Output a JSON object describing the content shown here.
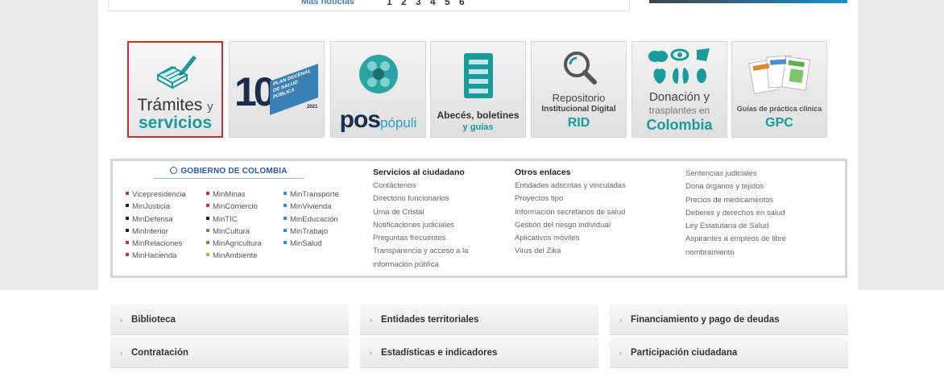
{
  "top": {
    "mas_noticias": "Más noticias",
    "pager": "1 2 3 4 5 6"
  },
  "tiles": {
    "tramites": {
      "l1": "Trámites",
      "l1_small": "y",
      "l2": "servicios"
    },
    "plan_decenal": {
      "number": "10",
      "text": "PLAN DECENAL DE SALUD PÚBLICA",
      "year": "2021"
    },
    "pospopuli": {
      "pos": "pos",
      "populi": "pópuli"
    },
    "abeces": {
      "l1": "Abecés, boletines",
      "l2": "y guías"
    },
    "repositorio": {
      "l1": "Repositorio",
      "l2": "Institucional Digital",
      "l3": "RID"
    },
    "donacion": {
      "l1": "Donación y",
      "l2": "trasplantes en",
      "l3": "Colombia"
    },
    "gpc": {
      "l1": "Guías de práctica clínica",
      "l2": "GPC"
    }
  },
  "gobierno": {
    "title": "GOBIERNO DE COLOMBIA",
    "col1": [
      "Vicepresidencia",
      "MinJusticia",
      "MinDefensa",
      "MinInterior",
      "MinRelaciones",
      "MinHacienda"
    ],
    "col2": [
      "MinMinas",
      "MinComercio",
      "MinTIC",
      "MinCultura",
      "MinAgricultura",
      "MinAmbiente"
    ],
    "col3": [
      "MinTransporte",
      "MinVivienda",
      "MinEducación",
      "MinTrabajo",
      "MinSalud"
    ]
  },
  "servicios": {
    "heading": "Servicios al ciudadano",
    "items": [
      "Contáctenos",
      "Directorio funcionarios",
      "Urna de Cristal",
      "Notificaciones judiciales",
      "Preguntas frecuentes",
      "Transparencia y acceso a la",
      "información pública"
    ]
  },
  "otros": {
    "heading": "Otros enlaces",
    "items": [
      "Entidades adscritas y vinculadas",
      "Proyectos tipo",
      "Información secretarios de salud",
      "Gestión del riesgo individual",
      "Aplicativos móviles",
      "Virus del Zika"
    ]
  },
  "col4": {
    "items": [
      "Sentencias judiciales",
      "Dona órganos y tejidos",
      "Precios de medicamentos",
      "Deberes y derechos en salud",
      "Ley Estatutaria de Salud",
      "Aspirantes a empleos de libre",
      "nombramiento"
    ]
  },
  "categories": {
    "row1": [
      "Biblioteca",
      "Entidades territoriales",
      "Financiamiento y pago de deudas"
    ],
    "row2": [
      "Contratación",
      "Estadísticas e indicadores",
      "Participación ciudadana"
    ]
  },
  "colors": {
    "teal": "#1b9a9a",
    "active_border": "#d22b2b",
    "gov_blue": "#2c5aa0"
  }
}
